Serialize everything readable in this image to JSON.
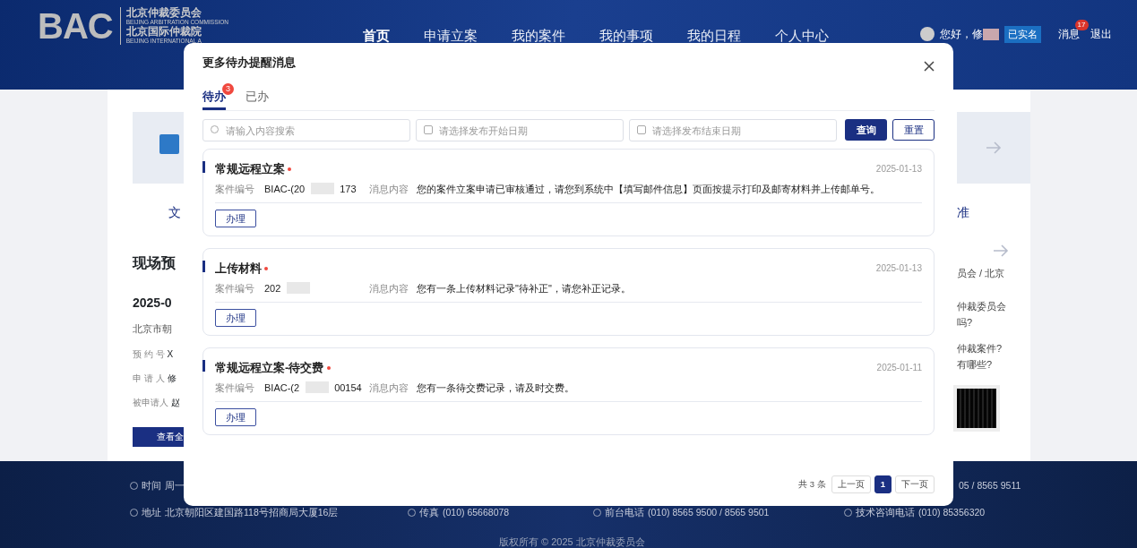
{
  "header": {
    "logo": "BAC",
    "org_name": "北京仲裁委员会",
    "org_name_en": "BEIJING ARBITRATION COMMISSION",
    "institute_name": "北京国际仲裁院",
    "institute_name_en": "BEIJING INTERNATIONAL A",
    "nav": [
      {
        "label": "首页",
        "selected": true
      },
      {
        "label": "申请立案",
        "selected": false
      },
      {
        "label": "我的案件",
        "selected": false
      },
      {
        "label": "我的事项",
        "selected": false
      },
      {
        "label": "我的日程",
        "selected": false
      },
      {
        "label": "个人中心",
        "selected": false
      }
    ],
    "user": {
      "greeting": "您好，修",
      "verified": "已实名",
      "messages": "消息",
      "message_count": "17",
      "logout": "退出"
    }
  },
  "background": {
    "left": {
      "tile_label": "文",
      "title": "现场预",
      "date": "2025-0",
      "place": "北京市朝",
      "fields": [
        {
          "label": "预 约 号",
          "value": "X"
        },
        {
          "label": "申 请 人",
          "value": "修"
        },
        {
          "label": "被申请人",
          "value": "赵"
        }
      ],
      "button": "查看全"
    },
    "right": {
      "tile_label": "准",
      "lines": [
        "员会 / 北京",
        "仲裁委员会",
        "吗?",
        "仲裁案件?",
        "有哪些?"
      ]
    }
  },
  "footer": {
    "hours_label": "时间",
    "hours": "周一",
    "phone_tail": "05 / 8565 9511",
    "address_label": "地址",
    "address": "北京朝阳区建国路118号招商局大厦16层",
    "fax_label": "传真",
    "fax": "(010)  65668078",
    "front_desk_label": "前台电话",
    "front_desk": "(010)  8565 9500 / 8565 9501",
    "tech_label": "技术咨询电话",
    "tech": "(010)  85356320",
    "copyright": "版权所有 © 2025 北京仲裁委员会"
  },
  "dialog": {
    "title": "更多待办提醒消息",
    "tabs": [
      {
        "label": "待办",
        "badge": "3",
        "selected": true
      },
      {
        "label": "已办",
        "selected": false
      }
    ],
    "search": {
      "placeholder": "请输入内容搜索"
    },
    "start_date": {
      "placeholder": "请选择发布开始日期"
    },
    "end_date": {
      "placeholder": "请选择发布结束日期"
    },
    "query_button": "查询",
    "reset_button": "重置",
    "items": [
      {
        "title": "常规远程立案",
        "required": true,
        "date": "2025-01-13",
        "case_label": "案件编号",
        "case_start": "BIAC-(20",
        "case_end": "173",
        "message_label": "消息内容",
        "message": "您的案件立案申请已审核通过，请您到系统中【填写邮件信息】页面按提示打印及邮寄材料并上传邮单号。",
        "action": "办理"
      },
      {
        "title": "上传材料",
        "required": true,
        "date": "2025-01-13",
        "case_label": "案件编号",
        "case_start": "202",
        "message_label": "消息内容",
        "message": "您有一条上传材料记录\"待补正\"，请您补正记录。",
        "action": "办理"
      },
      {
        "title": "常规远程立案-待交费",
        "required": true,
        "date": "2025-01-11",
        "case_label": "案件编号",
        "case_start": "BIAC-(2",
        "case_end": "00154",
        "message_label": "消息内容",
        "message": "您有一条待交费记录，请及时交费。",
        "action": "办理"
      }
    ],
    "pagination": {
      "total": "共 3 条",
      "prev": "上一页",
      "pages": [
        {
          "label": "1",
          "selected": true
        }
      ],
      "next": "下一页"
    }
  }
}
